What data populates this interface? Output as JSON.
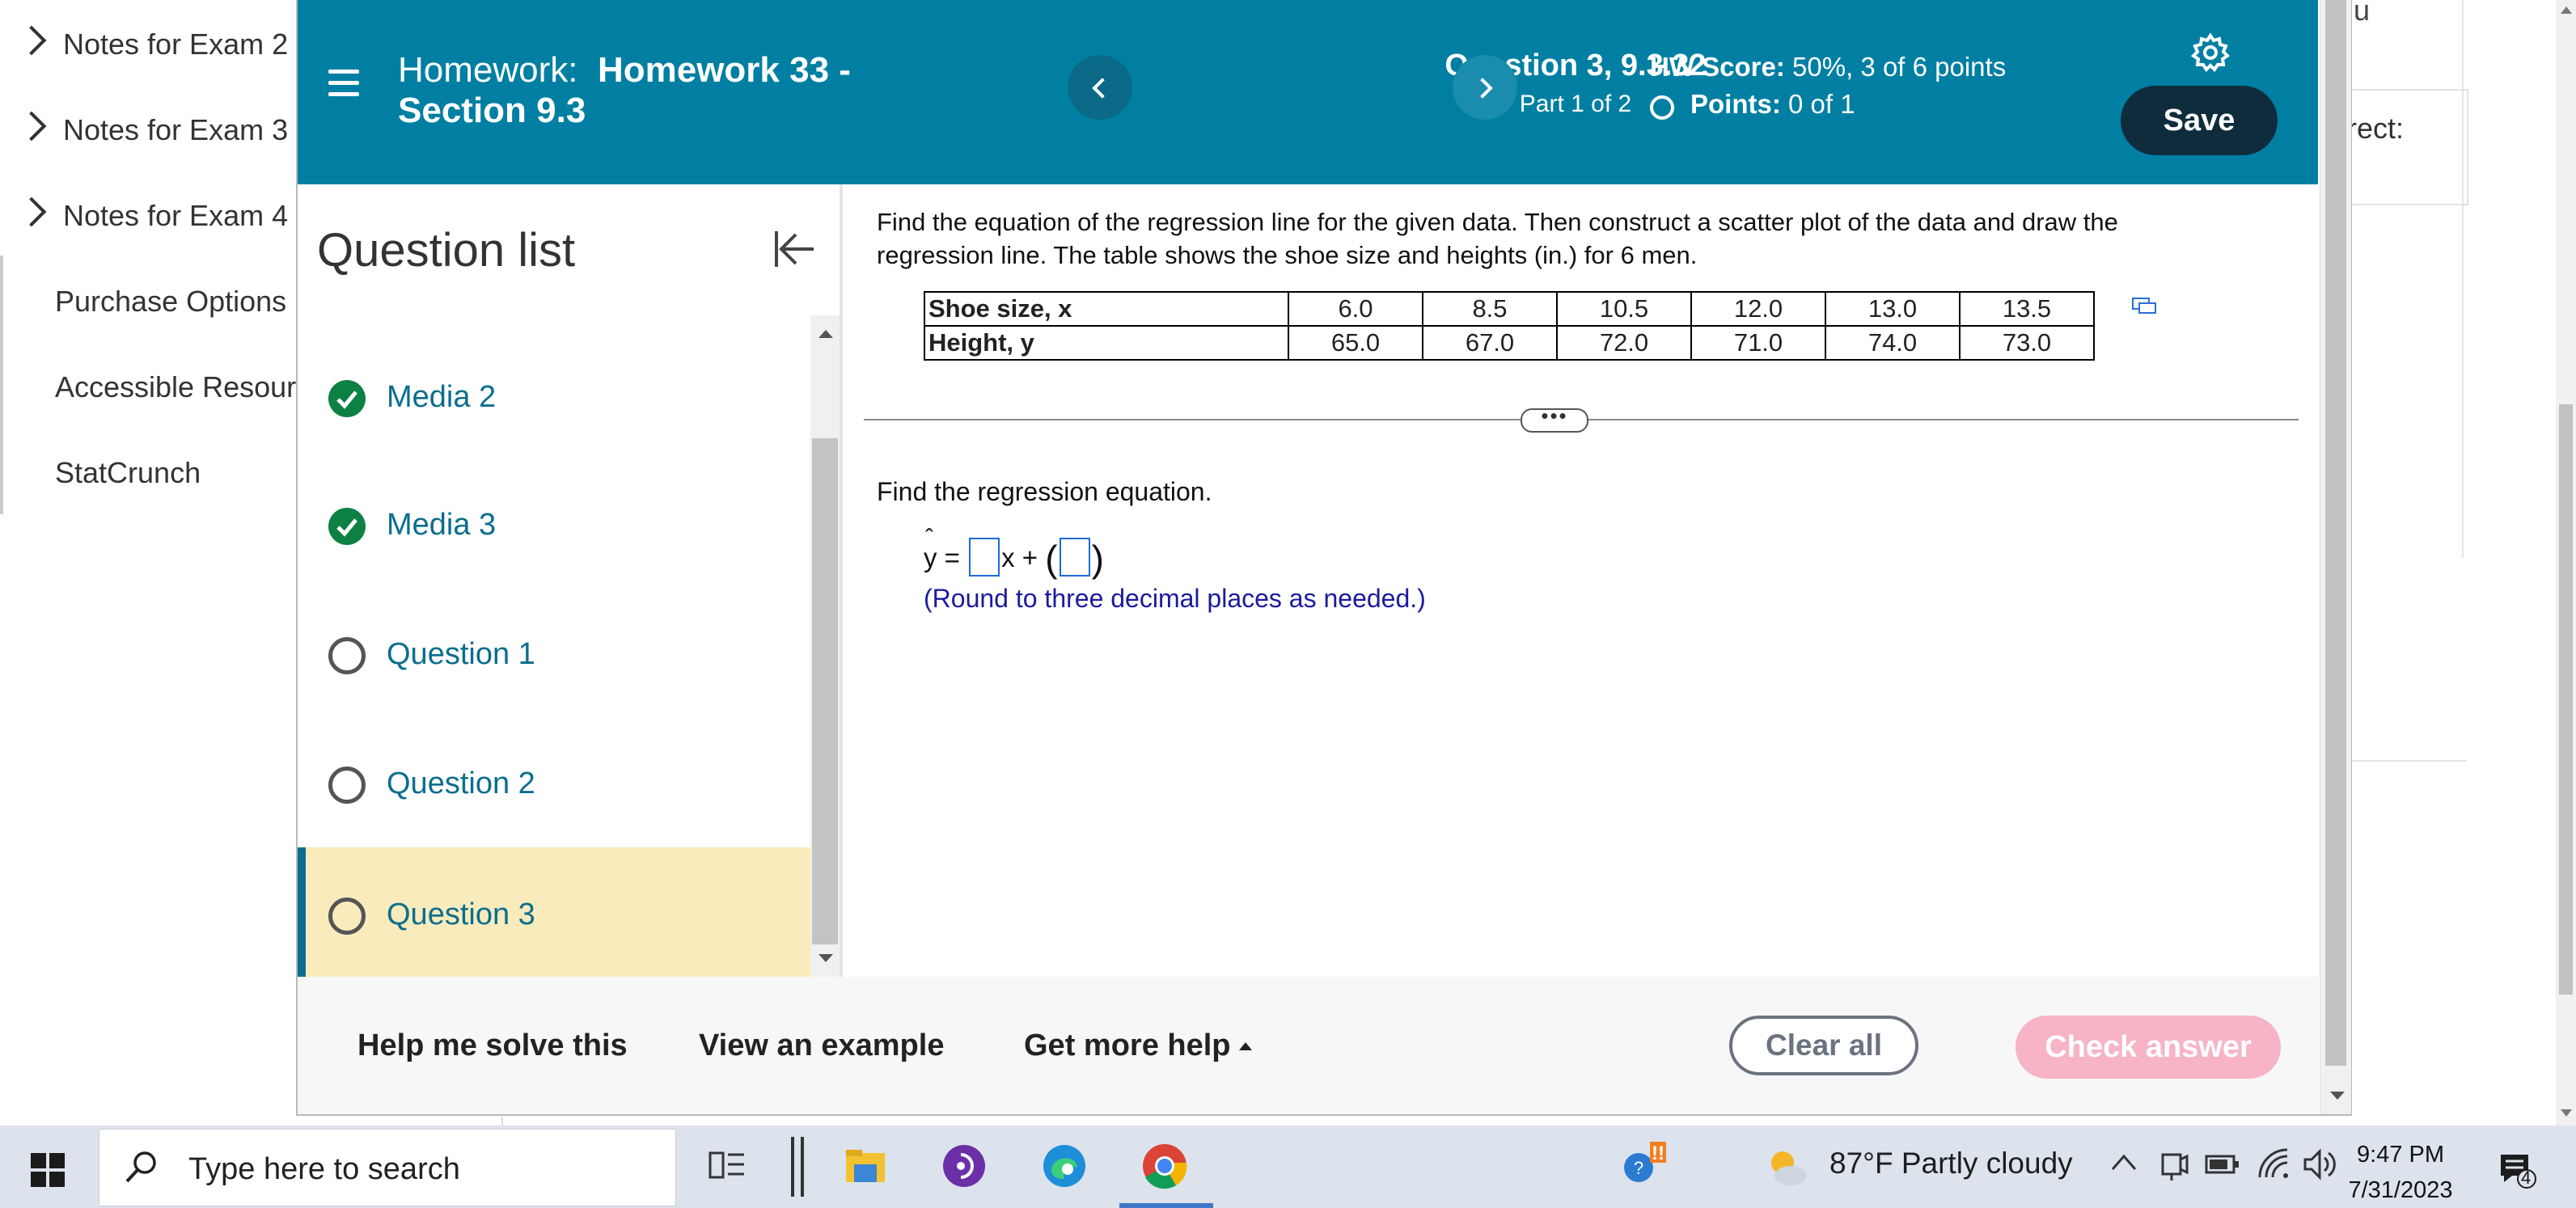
{
  "background": {
    "sidebar_items": [
      {
        "label": "Notes for Exam 2",
        "chevron": true
      },
      {
        "label": "Notes for Exam 3",
        "chevron": true
      },
      {
        "label": "Notes for Exam 4",
        "chevron": true
      },
      {
        "label": "Purchase Options",
        "chevron": false
      },
      {
        "label": "Accessible Resour",
        "chevron": false
      },
      {
        "label": "StatCrunch",
        "chevron": false
      }
    ],
    "right_fragment_top": "u",
    "right_fragment_card": "rect:"
  },
  "header": {
    "hw_prefix": "Homework:",
    "hw_name": "Homework 33 - Section 9.3",
    "question_title": "Question 3, 9.3.32",
    "question_part": "Part 1 of 2",
    "hw_score_label": "HW Score:",
    "hw_score_value": "50%, 3 of 6 points",
    "points_label": "Points:",
    "points_value": "0 of 1",
    "save_label": "Save",
    "colors": {
      "bar": "#007fa3",
      "save": "#0f2c3d"
    }
  },
  "question_list": {
    "title": "Question list",
    "items": [
      {
        "label": "Media 2",
        "status": "complete"
      },
      {
        "label": "Media 3",
        "status": "complete"
      },
      {
        "label": "Question 1",
        "status": "open"
      },
      {
        "label": "Question 2",
        "status": "open"
      },
      {
        "label": "Question 3",
        "status": "open",
        "active": true
      }
    ]
  },
  "question": {
    "prompt": "Find the equation of the regression line for the given data. Then construct a scatter plot of the data and draw the regression line. The table shows the shoe size and heights (in.) for 6 men.",
    "table": {
      "rows": [
        {
          "header": "Shoe size, x",
          "values": [
            "6.0",
            "8.5",
            "10.5",
            "12.0",
            "13.0",
            "13.5"
          ]
        },
        {
          "header": "Height, y",
          "values": [
            "65.0",
            "67.0",
            "72.0",
            "71.0",
            "74.0",
            "73.0"
          ]
        }
      ]
    },
    "more_toggle": "•••",
    "subprompt": "Find the regression equation.",
    "equation": {
      "lhs": "y",
      "eq": "=",
      "x_term": "x",
      "plus": "+",
      "open_paren": "(",
      "close_paren": ")"
    },
    "answer_slope": "",
    "answer_intercept": "",
    "round_note": "(Round to three decimal places as needed.)"
  },
  "footer": {
    "help_solve": "Help me solve this",
    "view_example": "View an example",
    "more_help": "Get more help",
    "clear_all": "Clear all",
    "check_answer": "Check answer"
  },
  "taskbar": {
    "search_placeholder": "Type here to search",
    "weather": "87°F  Partly cloudy",
    "time": "9:47 PM",
    "date": "7/31/2023",
    "notification_count": "4"
  }
}
